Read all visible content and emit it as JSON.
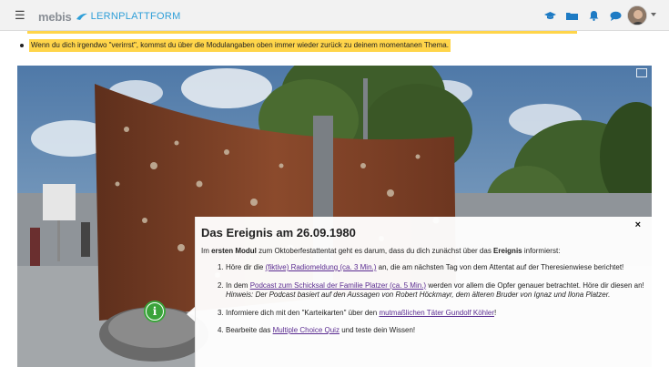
{
  "header": {
    "logo_primary": "mebis",
    "logo_secondary": "LERNPLATTFORM",
    "icons": [
      "menu-icon",
      "graduation-cap-icon",
      "folder-icon",
      "bell-icon",
      "chat-icon",
      "avatar"
    ]
  },
  "notice": {
    "bullet_text": "Wenn du dich irgendwo \"verirrst\", kommst du über die Modulangaben oben immer wieder zurück zu deinem momentanen Thema."
  },
  "panel": {
    "title": "Das Ereignis am 26.09.1980",
    "intro_prefix": "Im ",
    "intro_bold1": "ersten Modul",
    "intro_mid": " zum Oktoberfestattentat geht es darum, dass du dich zunächst über das ",
    "intro_bold2": "Ereignis",
    "intro_suffix": " informierst:",
    "items": [
      {
        "num": "1.",
        "pre": "Höre dir die ",
        "link": "(fiktive) Radiomeldung (ca. 3 Min.)",
        "post": " an, die am nächsten Tag von dem Attentat auf der Theresienwiese berichtet!"
      },
      {
        "num": "2.",
        "pre": "In dem ",
        "link": "Podcast zum Schicksal der Familie Platzer (ca. 5 Min.)",
        "post": " werden vor allem die Opfer genauer betrachtet. Höre dir diesen an!",
        "hint": "Hinweis: Der Podcast basiert auf den Aussagen von Robert Höckmayr, dem älteren Bruder von Ignaz und Ilona Platzer."
      },
      {
        "num": "3.",
        "pre": "Informiere dich mit den \"Karteikarten\" über den ",
        "link": "mutmaßlichen Täter Gundolf Köhler",
        "post": "!"
      },
      {
        "num": "4.",
        "pre": "Bearbeite das ",
        "link": "Multiple Choice Quiz",
        "post": " und teste dein Wissen!"
      }
    ],
    "close_symbol": "×"
  },
  "hotspot": {
    "symbol": "i"
  },
  "colors": {
    "highlight": "#ffd54a",
    "link": "#5b2c91",
    "logo_accent": "#2f9fd8",
    "hotspot_green": "#3ba33b"
  }
}
